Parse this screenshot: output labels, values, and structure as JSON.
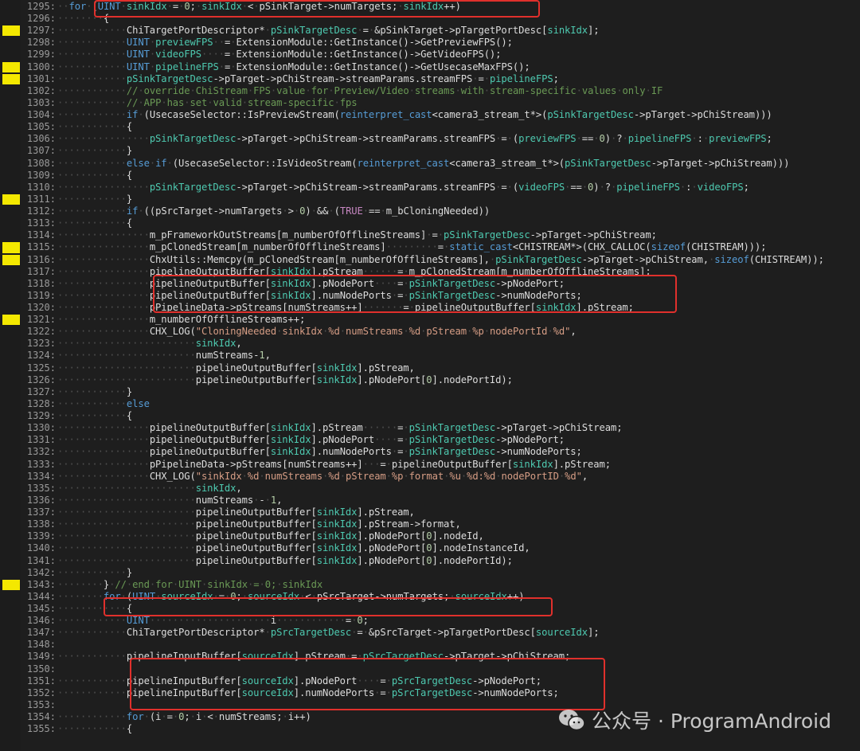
{
  "colors": {
    "background": "#1e1e1e",
    "keyword": "#569cd6",
    "variable": "#4ec9b0",
    "string": "#d69d85",
    "comment": "#6a9955",
    "macro": "#c586c0",
    "line_number": "#9a9a9a",
    "change_marker": "#f4e800",
    "highlight_box": "#e0302c"
  },
  "editor": {
    "lines": [
      {
        "n": "1295:",
        "code": "··for·(UINT·sinkIdx·=·0;·sinkIdx·<·pSinkTarget->numTargets;·sinkIdx++)",
        "mark": false
      },
      {
        "n": "1296:",
        "code": "········{",
        "mark": false
      },
      {
        "n": "1297:",
        "code": "············ChiTargetPortDescriptor*·pSinkTargetDesc·=·&pSinkTarget->pTargetPortDesc[sinkIdx];",
        "mark": true
      },
      {
        "n": "1298:",
        "code": "············UINT·previewFPS··=·ExtensionModule::GetInstance()->GetPreviewFPS();",
        "mark": false
      },
      {
        "n": "1299:",
        "code": "············UINT·videoFPS····=·ExtensionModule::GetInstance()->GetVideoFPS();",
        "mark": false
      },
      {
        "n": "1300:",
        "code": "············UINT·pipelineFPS·=·ExtensionModule::GetInstance()->GetUsecaseMaxFPS();",
        "mark": true
      },
      {
        "n": "1301:",
        "code": "············pSinkTargetDesc->pTarget->pChiStream->streamParams.streamFPS·=·pipelineFPS;",
        "mark": true
      },
      {
        "n": "1302:",
        "code": "············//·override·ChiStream·FPS·value·for·Preview/Video·streams·with·stream-specific·values·only·IF",
        "mark": false
      },
      {
        "n": "1303:",
        "code": "············//·APP·has·set·valid·stream-specific·fps",
        "mark": false
      },
      {
        "n": "1304:",
        "code": "············if·(UsecaseSelector::IsPreviewStream(reinterpret_cast<camera3_stream_t*>(pSinkTargetDesc->pTarget->pChiStream)))",
        "mark": false
      },
      {
        "n": "1305:",
        "code": "············{",
        "mark": false
      },
      {
        "n": "1306:",
        "code": "················pSinkTargetDesc->pTarget->pChiStream->streamParams.streamFPS·=·(previewFPS·==·0)·?·pipelineFPS·:·previewFPS;",
        "mark": false
      },
      {
        "n": "1307:",
        "code": "············}",
        "mark": false
      },
      {
        "n": "1308:",
        "code": "············else·if·(UsecaseSelector::IsVideoStream(reinterpret_cast<camera3_stream_t*>(pSinkTargetDesc->pTarget->pChiStream)))",
        "mark": false
      },
      {
        "n": "1309:",
        "code": "············{",
        "mark": false
      },
      {
        "n": "1310:",
        "code": "················pSinkTargetDesc->pTarget->pChiStream->streamParams.streamFPS·=·(videoFPS·==·0)·?·pipelineFPS·:·videoFPS;",
        "mark": false
      },
      {
        "n": "1311:",
        "code": "············}",
        "mark": true
      },
      {
        "n": "1312:",
        "code": "············if·((pSrcTarget->numTargets·>·0)·&&·(TRUE·==·m_bCloningNeeded))",
        "mark": false
      },
      {
        "n": "1313:",
        "code": "············{",
        "mark": false
      },
      {
        "n": "1314:",
        "code": "················m_pFrameworkOutStreams[m_numberOfOfflineStreams]·=·pSinkTargetDesc->pTarget->pChiStream;",
        "mark": false
      },
      {
        "n": "1315:",
        "code": "················m_pClonedStream[m_numberOfOfflineStreams]·········=·static_cast<CHISTREAM*>(CHX_CALLOC(sizeof(CHISTREAM)));",
        "mark": true
      },
      {
        "n": "1316:",
        "code": "················ChxUtils::Memcpy(m_pClonedStream[m_numberOfOfflineStreams],·pSinkTargetDesc->pTarget->pChiStream,·sizeof(CHISTREAM));",
        "mark": true
      },
      {
        "n": "1317:",
        "code": "················pipelineOutputBuffer[sinkIdx].pStream······=·m_pClonedStream[m_numberOfOfflineStreams];",
        "mark": false
      },
      {
        "n": "1318:",
        "code": "················pipelineOutputBuffer[sinkIdx].pNodePort····=·pSinkTargetDesc->pNodePort;",
        "mark": false
      },
      {
        "n": "1319:",
        "code": "················pipelineOutputBuffer[sinkIdx].numNodePorts·=·pSinkTargetDesc->numNodePorts;",
        "mark": false
      },
      {
        "n": "1320:",
        "code": "················pPipelineData->pStreams[numStreams++]·······=·pipelineOutputBuffer[sinkIdx].pStream;",
        "mark": false
      },
      {
        "n": "1321:",
        "code": "················m_numberOfOfflineStreams++;",
        "mark": true
      },
      {
        "n": "1322:",
        "code": "················CHX_LOG(\"CloningNeeded·sinkIdx·%d·numStreams·%d·pStream·%p·nodePortId·%d\",",
        "mark": false
      },
      {
        "n": "1323:",
        "code": "························sinkIdx,",
        "mark": false
      },
      {
        "n": "1324:",
        "code": "························numStreams-1,",
        "mark": false
      },
      {
        "n": "1325:",
        "code": "························pipelineOutputBuffer[sinkIdx].pStream,",
        "mark": false
      },
      {
        "n": "1326:",
        "code": "························pipelineOutputBuffer[sinkIdx].pNodePort[0].nodePortId);",
        "mark": false
      },
      {
        "n": "1327:",
        "code": "············}",
        "mark": false
      },
      {
        "n": "1328:",
        "code": "············else",
        "mark": false
      },
      {
        "n": "1329:",
        "code": "············{",
        "mark": false
      },
      {
        "n": "1330:",
        "code": "················pipelineOutputBuffer[sinkIdx].pStream······=·pSinkTargetDesc->pTarget->pChiStream;",
        "mark": false
      },
      {
        "n": "1331:",
        "code": "················pipelineOutputBuffer[sinkIdx].pNodePort····=·pSinkTargetDesc->pNodePort;",
        "mark": false
      },
      {
        "n": "1332:",
        "code": "················pipelineOutputBuffer[sinkIdx].numNodePorts·=·pSinkTargetDesc->numNodePorts;",
        "mark": false
      },
      {
        "n": "1333:",
        "code": "················pPipelineData->pStreams[numStreams++]···=·pipelineOutputBuffer[sinkIdx].pStream;",
        "mark": false
      },
      {
        "n": "1334:",
        "code": "················CHX_LOG(\"sinkIdx·%d·numStreams·%d·pStream·%p·format·%u·%d:%d·nodePortID·%d\",",
        "mark": false
      },
      {
        "n": "1335:",
        "code": "························sinkIdx,",
        "mark": false
      },
      {
        "n": "1336:",
        "code": "························numStreams·-·1,",
        "mark": false
      },
      {
        "n": "1337:",
        "code": "························pipelineOutputBuffer[sinkIdx].pStream,",
        "mark": false
      },
      {
        "n": "1338:",
        "code": "························pipelineOutputBuffer[sinkIdx].pStream->format,",
        "mark": false
      },
      {
        "n": "1339:",
        "code": "························pipelineOutputBuffer[sinkIdx].pNodePort[0].nodeId,",
        "mark": false
      },
      {
        "n": "1340:",
        "code": "························pipelineOutputBuffer[sinkIdx].pNodePort[0].nodeInstanceId,",
        "mark": false
      },
      {
        "n": "1341:",
        "code": "························pipelineOutputBuffer[sinkIdx].pNodePort[0].nodePortId);",
        "mark": false
      },
      {
        "n": "1342:",
        "code": "············}",
        "mark": false
      },
      {
        "n": "1343:",
        "code": "········}·//·end·for·UINT·sinkIdx·=·0;·sinkIdx",
        "mark": true
      },
      {
        "n": "1344:",
        "code": "········for·(UINT·sourceIdx·=·0;·sourceIdx·<·pSrcTarget->numTargets;·sourceIdx++)",
        "mark": false
      },
      {
        "n": "1345:",
        "code": "············{",
        "mark": false
      },
      {
        "n": "1346:",
        "code": "············UINT·····················i············=·0;",
        "mark": false
      },
      {
        "n": "1347:",
        "code": "············ChiTargetPortDescriptor*·pSrcTargetDesc·=·&pSrcTarget->pTargetPortDesc[sourceIdx];",
        "mark": false
      },
      {
        "n": "1348:",
        "code": "",
        "mark": false
      },
      {
        "n": "1349:",
        "code": "············pipelineInputBuffer[sourceIdx].pStream·=·pSrcTargetDesc->pTarget->pChiStream;",
        "mark": false
      },
      {
        "n": "1350:",
        "code": "",
        "mark": false
      },
      {
        "n": "1351:",
        "code": "············pipelineInputBuffer[sourceIdx].pNodePort····=·pSrcTargetDesc->pNodePort;",
        "mark": false
      },
      {
        "n": "1352:",
        "code": "············pipelineInputBuffer[sourceIdx].numNodePorts·=·pSrcTargetDesc->numNodePorts;",
        "mark": false
      },
      {
        "n": "1353:",
        "code": "",
        "mark": false
      },
      {
        "n": "1354:",
        "code": "············for·(i·=·0;·i·<·numStreams;·i++)",
        "mark": false
      },
      {
        "n": "1355:",
        "code": "············{",
        "mark": false
      }
    ]
  },
  "watermark": {
    "text": "公众号 · ProgramAndroid",
    "icon": "wechat-icon"
  }
}
